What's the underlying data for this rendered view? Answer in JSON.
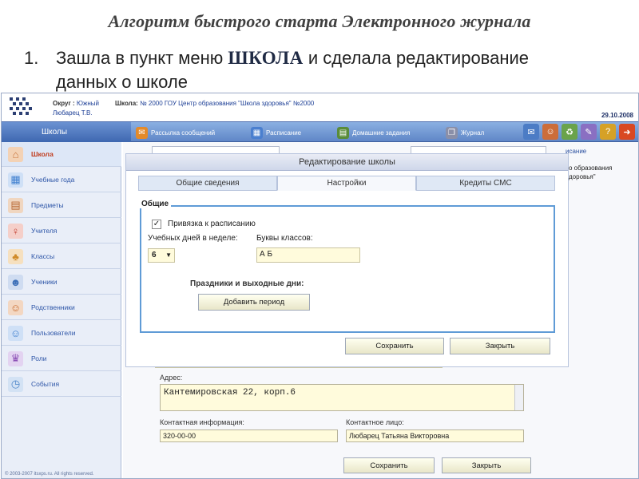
{
  "slide": {
    "title": "Алгоритм быстрого старта Электронного журнала",
    "step_number": "1.",
    "step_text_before": "Зашла в пункт меню",
    "step_keyword": "ШКОЛА",
    "step_text_after": "и сделала редактирование",
    "step_text_line2": "данных о школе"
  },
  "app": {
    "okrug_label": "Округ :",
    "okrug_value": "Южный",
    "user_name": "Любарец Т.В.",
    "school_label": "Школа:",
    "school_value": "№ 2000 ГОУ Центр образования \"Школа здоровья\" №2000",
    "date": "29.10.2008",
    "copyright": "© 2003-2007 itsxps.ru. All rights reserved."
  },
  "navbar": {
    "schools": "Школы",
    "items": [
      {
        "label": "Рассылка сообщений",
        "icon": "envelope-icon",
        "color": "#e38a2a"
      },
      {
        "label": "Расписание",
        "icon": "calendar-icon",
        "color": "#4a7fcf"
      },
      {
        "label": "Домашние задания",
        "icon": "book-icon",
        "color": "#5a8c3a"
      },
      {
        "label": "Журнал",
        "icon": "journal-icon",
        "color": "#8a8fa8"
      }
    ],
    "right_icons": [
      {
        "icon": "mail-icon",
        "color": "#4c7cc5",
        "glyph": "✉"
      },
      {
        "icon": "users-icon",
        "color": "#cc6d3a",
        "glyph": "☺"
      },
      {
        "icon": "trash-icon",
        "color": "#6aa34b",
        "glyph": "♻"
      },
      {
        "icon": "tools-icon",
        "color": "#8a6fc2",
        "glyph": "✎"
      },
      {
        "icon": "help-icon",
        "color": "#d6a126",
        "glyph": "?"
      },
      {
        "icon": "exit-icon",
        "color": "#d94822",
        "glyph": "➜"
      }
    ]
  },
  "sidebar": {
    "items": [
      {
        "label": "Школа",
        "icon": "school-icon",
        "color": "#c8743c",
        "glyph": "⌂",
        "active": true
      },
      {
        "label": "Учебные года",
        "icon": "calendar-icon",
        "color": "#3f7fcf",
        "glyph": "▦",
        "active": false
      },
      {
        "label": "Предметы",
        "icon": "books-icon",
        "color": "#b5642d",
        "glyph": "▤",
        "active": false
      },
      {
        "label": "Учителя",
        "icon": "teacher-icon",
        "color": "#c23d2e",
        "glyph": "♀",
        "active": false
      },
      {
        "label": "Классы",
        "icon": "class-icon",
        "color": "#d08b2a",
        "glyph": "♣",
        "active": false
      },
      {
        "label": "Ученики",
        "icon": "student-icon",
        "color": "#3c6fb8",
        "glyph": "☻",
        "active": false
      },
      {
        "label": "Родственники",
        "icon": "relatives-icon",
        "color": "#c86a2d",
        "glyph": "☺",
        "active": false
      },
      {
        "label": "Пользователи",
        "icon": "users-icon",
        "color": "#3f7fcf",
        "glyph": "☺",
        "active": false
      },
      {
        "label": "Роли",
        "icon": "roles-icon",
        "color": "#8a4fb5",
        "glyph": "♛",
        "active": false
      },
      {
        "label": "События",
        "icon": "events-icon",
        "color": "#4d86c9",
        "glyph": "◷",
        "active": false
      }
    ]
  },
  "background": {
    "col_head": "исание",
    "col_text1": "о образования",
    "col_text2": "доровья\"",
    "address_label": "Адрес:",
    "address_value": "Кантемировская 22, корп.6",
    "contact_info_label": "Контактная информация:",
    "contact_info_value": "320-00-00",
    "contact_person_label": "Контактное лицо:",
    "contact_person_value": "Любарец Татьяна Викторовна",
    "save_button": "Сохранить",
    "close_button": "Закрыть"
  },
  "dialog": {
    "title": "Редактирование школы",
    "tabs": [
      "Общие сведения",
      "Настройки",
      "Кредиты СМС"
    ],
    "active_tab": "Настройки",
    "group_legend": "Общие",
    "schedule_checkbox_label": "Привязка к расписанию",
    "schedule_checked": true,
    "check_glyph": "✓",
    "days_label": "Учебных дней в неделе:",
    "days_value": "6",
    "letters_label": "Буквы классов:",
    "letters_value": "А Б",
    "holidays_label": "Праздники и выходные дни:",
    "add_period_button": "Добавить период",
    "save_button": "Сохранить",
    "close_button": "Закрыть"
  }
}
